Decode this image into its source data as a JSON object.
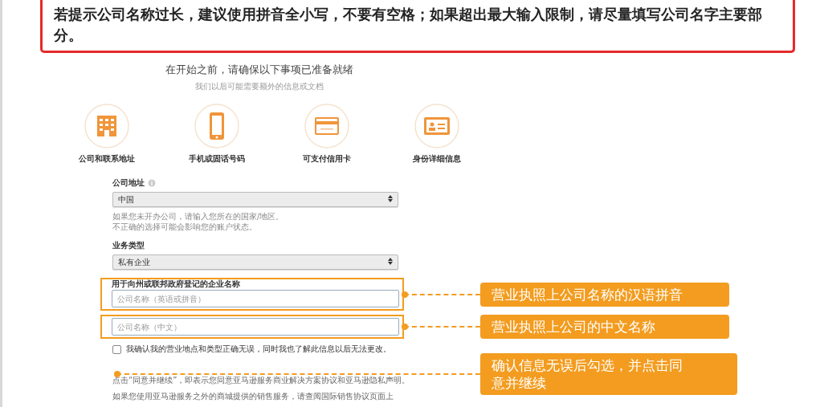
{
  "notice": "若提示公司名称过长，建议使用拼音全小写，不要有空格；如果超出最大输入限制，请尽量填写公司名字主要部分。",
  "intro": {
    "title": "在开始之前，请确保以下事项已准备就绪",
    "subtitle": "我们以后可能需要额外的信息或文档"
  },
  "prerequisites": [
    {
      "kind": "building",
      "label": "公司和联系地址"
    },
    {
      "kind": "phone",
      "label": "手机或固话号码"
    },
    {
      "kind": "card",
      "label": "可支付信用卡"
    },
    {
      "kind": "id",
      "label": "身份详细信息"
    }
  ],
  "form": {
    "selects": [
      {
        "label": "公司地址",
        "info": true,
        "value": "中国",
        "help": [
          "如果您未开办公司，请输入您所在的国家/地区。",
          "不正确的选择可能会影响您的账户状态。"
        ]
      },
      {
        "label": "业务类型",
        "value": "私有企业"
      }
    ],
    "name_label": "用于向州或联邦政府登记的企业名称",
    "name_inputs": [
      {
        "placeholder": "公司名称（英语或拼音）",
        "annotation": "营业执照上公司名称的汉语拼音"
      },
      {
        "placeholder": "公司名称（中文）",
        "annotation": "营业执照上公司的中文名称"
      }
    ],
    "confirm": {
      "label": "我确认我的营业地点和类型正确无误，同时我也了解此信息以后无法更改。",
      "checked": false,
      "annotation": "确认信息无误后勾选，并点击同意并继续"
    },
    "footer": [
      "点击“同意并继续”，即表示您同意亚马逊服务商业解决方案协议和亚马逊隐私声明。",
      "如果您使用亚马逊服务之外的商城提供的销售服务，请查阅国际销售协议页面上"
    ]
  }
}
